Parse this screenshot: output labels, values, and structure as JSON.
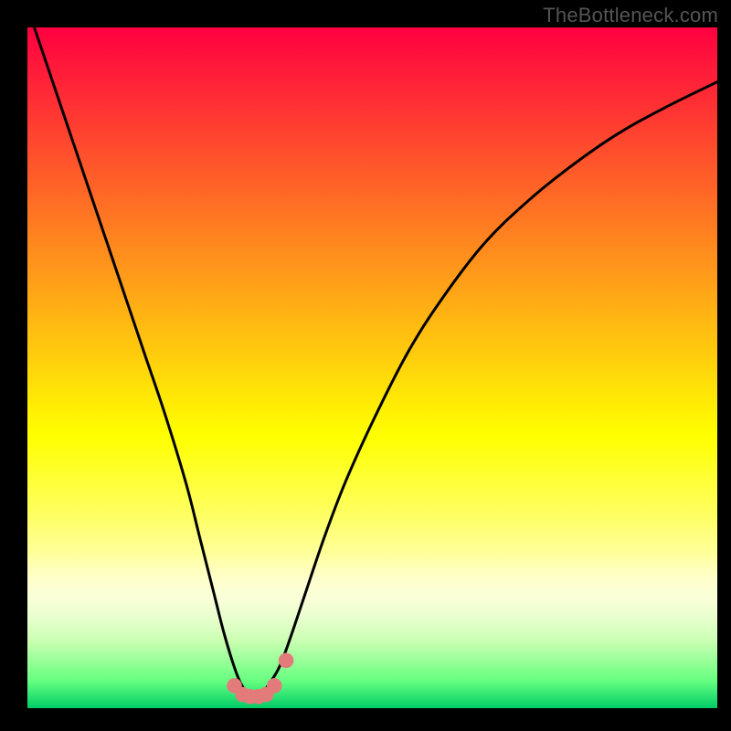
{
  "watermark": "TheBottleneck.com",
  "chart_data": {
    "type": "line",
    "title": "",
    "xlabel": "",
    "ylabel": "",
    "xlim": [
      0,
      100
    ],
    "ylim": [
      0,
      100
    ],
    "grid": false,
    "series": [
      {
        "name": "bottleneck-curve",
        "color": "#000000",
        "x": [
          1,
          3,
          5,
          8,
          11,
          14,
          17,
          20,
          23,
          25,
          27,
          28.5,
          30,
          31,
          32,
          33,
          34,
          35,
          36.5,
          38,
          40,
          43,
          46,
          50,
          55,
          60,
          66,
          72,
          78,
          85,
          92,
          100
        ],
        "y": [
          100,
          94,
          88,
          79,
          70,
          61,
          52,
          43,
          33,
          25,
          17,
          11,
          6,
          3.5,
          2.2,
          1.8,
          2.2,
          3.5,
          6,
          10,
          16,
          25,
          33,
          42,
          52,
          60,
          68,
          74,
          79,
          84,
          88,
          92
        ]
      }
    ],
    "markers": [
      {
        "name": "foot-left-1",
        "x": 30.0,
        "y": 3.3,
        "r": 1.1,
        "color": "#e47b7b"
      },
      {
        "name": "foot-left-2",
        "x": 31.2,
        "y": 2.0,
        "r": 1.1,
        "color": "#e47b7b"
      },
      {
        "name": "foot-mid-1",
        "x": 32.3,
        "y": 1.7,
        "r": 1.1,
        "color": "#e47b7b"
      },
      {
        "name": "foot-mid-2",
        "x": 33.5,
        "y": 1.7,
        "r": 1.1,
        "color": "#e47b7b"
      },
      {
        "name": "foot-right-1",
        "x": 34.6,
        "y": 2.0,
        "r": 1.1,
        "color": "#e47b7b"
      },
      {
        "name": "foot-right-2",
        "x": 35.8,
        "y": 3.3,
        "r": 1.1,
        "color": "#e47b7b"
      },
      {
        "name": "foot-right-3",
        "x": 37.5,
        "y": 7.0,
        "r": 1.1,
        "color": "#e47b7b"
      }
    ]
  }
}
